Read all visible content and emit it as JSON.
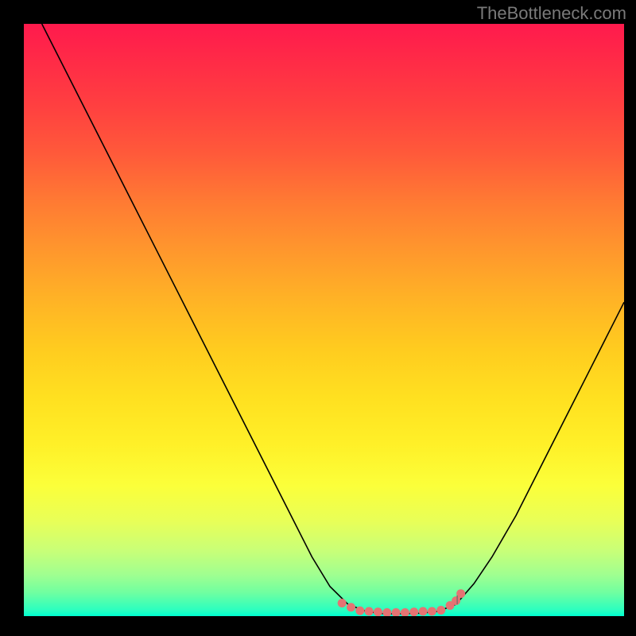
{
  "watermark": "TheBottleneck.com",
  "chart_data": {
    "type": "line",
    "title": "",
    "xlabel": "",
    "ylabel": "",
    "xlim": [
      0,
      100
    ],
    "ylim": [
      0,
      100
    ],
    "series": [
      {
        "name": "curve",
        "color": "#000000",
        "points": [
          {
            "x": 3.0,
            "y": 100.0
          },
          {
            "x": 8.0,
            "y": 90.0
          },
          {
            "x": 14.0,
            "y": 78.0
          },
          {
            "x": 20.0,
            "y": 66.0
          },
          {
            "x": 26.0,
            "y": 54.0
          },
          {
            "x": 32.0,
            "y": 42.0
          },
          {
            "x": 38.0,
            "y": 30.0
          },
          {
            "x": 44.0,
            "y": 18.0
          },
          {
            "x": 48.0,
            "y": 10.0
          },
          {
            "x": 51.0,
            "y": 5.0
          },
          {
            "x": 54.0,
            "y": 2.0
          },
          {
            "x": 57.0,
            "y": 0.8
          },
          {
            "x": 60.0,
            "y": 0.4
          },
          {
            "x": 63.0,
            "y": 0.4
          },
          {
            "x": 66.0,
            "y": 0.5
          },
          {
            "x": 69.0,
            "y": 0.8
          },
          {
            "x": 72.0,
            "y": 2.0
          },
          {
            "x": 75.0,
            "y": 5.5
          },
          {
            "x": 78.0,
            "y": 10.0
          },
          {
            "x": 82.0,
            "y": 17.0
          },
          {
            "x": 86.0,
            "y": 25.0
          },
          {
            "x": 90.0,
            "y": 33.0
          },
          {
            "x": 94.0,
            "y": 41.0
          },
          {
            "x": 98.0,
            "y": 49.0
          },
          {
            "x": 100.0,
            "y": 53.0
          }
        ]
      },
      {
        "name": "bottom-markers",
        "color": "#e57373",
        "points": [
          {
            "x": 53.0,
            "y": 2.2
          },
          {
            "x": 54.5,
            "y": 1.5
          },
          {
            "x": 56.0,
            "y": 0.9
          },
          {
            "x": 57.5,
            "y": 0.8
          },
          {
            "x": 59.0,
            "y": 0.7
          },
          {
            "x": 60.5,
            "y": 0.6
          },
          {
            "x": 62.0,
            "y": 0.6
          },
          {
            "x": 63.5,
            "y": 0.6
          },
          {
            "x": 65.0,
            "y": 0.7
          },
          {
            "x": 66.5,
            "y": 0.8
          },
          {
            "x": 68.0,
            "y": 0.8
          },
          {
            "x": 69.5,
            "y": 1.0
          },
          {
            "x": 71.0,
            "y": 1.8
          },
          {
            "x": 72.0,
            "y": 2.6
          },
          {
            "x": 72.8,
            "y": 3.8
          }
        ]
      }
    ],
    "extra_ticks": [
      {
        "x": 72.2,
        "y0": 2.0,
        "y1": 3.5
      }
    ],
    "gradient_stops": [
      {
        "pos": 0,
        "color": "#ff1a4d"
      },
      {
        "pos": 50,
        "color": "#ffd020"
      },
      {
        "pos": 100,
        "color": "#00ffc8"
      }
    ]
  }
}
